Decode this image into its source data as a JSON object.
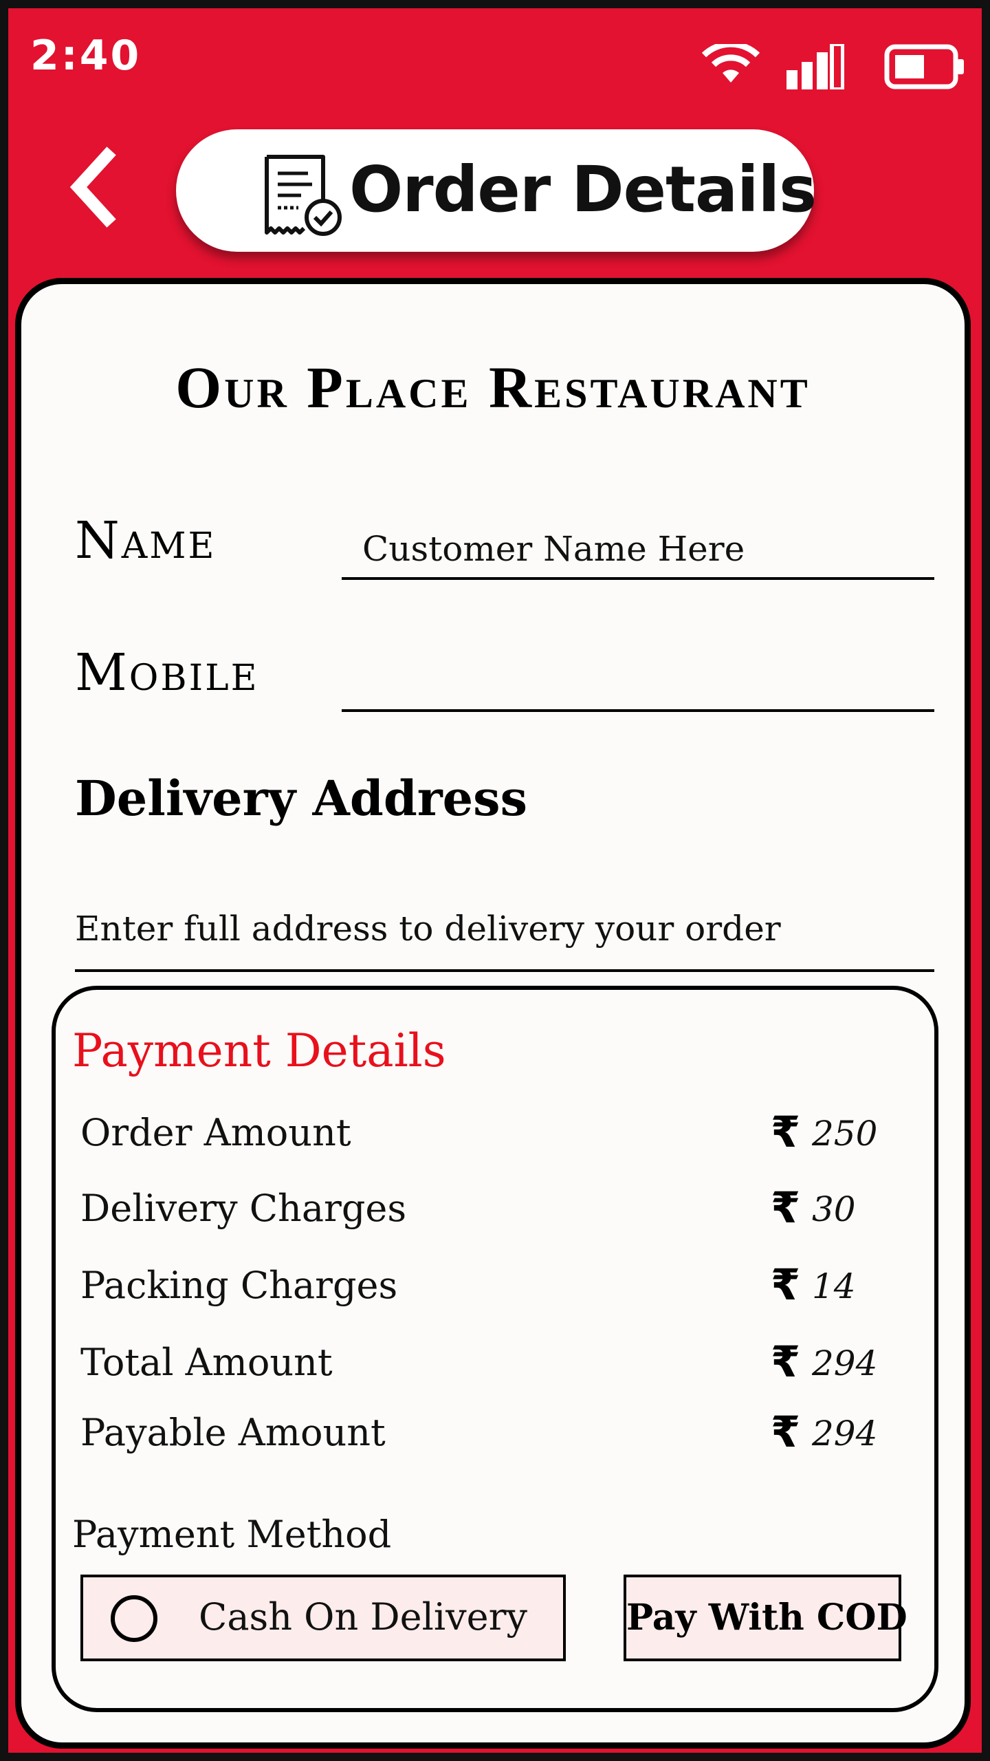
{
  "status_bar": {
    "time": "2:40"
  },
  "header": {
    "title": "Order Details"
  },
  "restaurant": {
    "name": "Our Place Restaurant"
  },
  "form": {
    "name_label": "Name",
    "name_placeholder": "Customer Name Here",
    "mobile_label": "Mobile",
    "mobile_value": "",
    "address_heading": "Delivery Address",
    "address_placeholder": "Enter full address to delivery your order"
  },
  "payment": {
    "title": "Payment Details",
    "currency_symbol": "₹",
    "rows": [
      {
        "label": "Order Amount",
        "amount": "250"
      },
      {
        "label": "Delivery Charges",
        "amount": "30"
      },
      {
        "label": "Packing Charges",
        "amount": "14"
      },
      {
        "label": "Total Amount",
        "amount": "294"
      },
      {
        "label": "Payable Amount",
        "amount": "294"
      }
    ],
    "method_label": "Payment Method",
    "method_option": "Cash On Delivery",
    "pay_button": "Pay With COD"
  },
  "colors": {
    "primary": "#e21230",
    "accent_text": "#e8101c",
    "card_bg": "#fcfbf9",
    "button_bg": "#fcecec"
  }
}
